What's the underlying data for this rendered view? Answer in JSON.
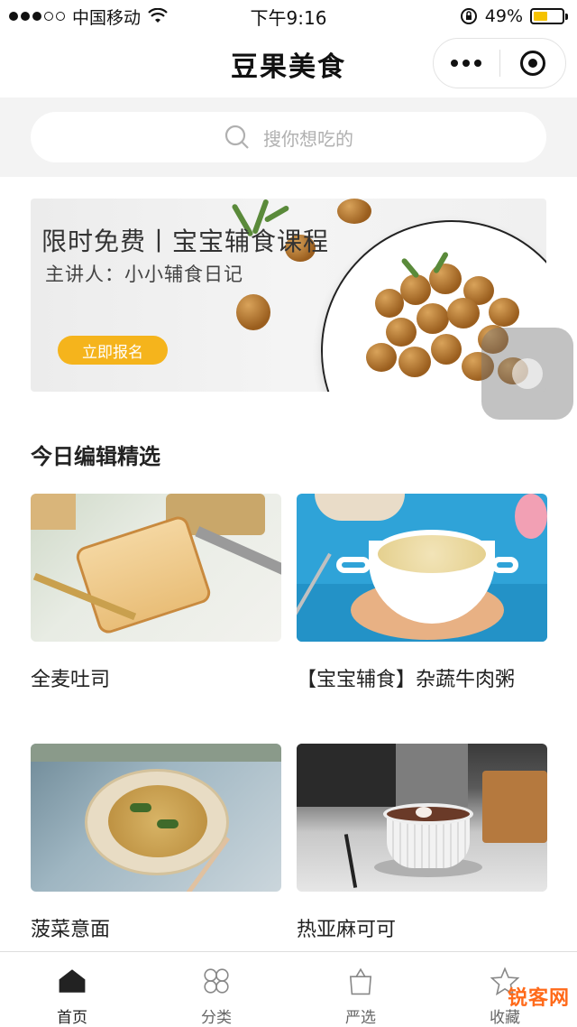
{
  "status_bar": {
    "carrier": "中国移动",
    "time": "下午9:16",
    "battery": "49%",
    "battery_level": 0.49
  },
  "nav": {
    "title": "豆果美食"
  },
  "search": {
    "placeholder": "搜你想吃的"
  },
  "banner": {
    "title": "限时免费丨宝宝辅食课程",
    "subtitle": "主讲人：小小辅食日记",
    "cta": "立即报名"
  },
  "section": {
    "title": "今日编辑精选"
  },
  "cards": [
    {
      "label": "全麦吐司"
    },
    {
      "label": "【宝宝辅食】杂蔬牛肉粥"
    },
    {
      "label": "菠菜意面"
    },
    {
      "label": "热亚麻可可"
    }
  ],
  "tabs": [
    {
      "label": "首页",
      "icon": "home-icon"
    },
    {
      "label": "分类",
      "icon": "category-icon"
    },
    {
      "label": "严选",
      "icon": "bag-icon"
    },
    {
      "label": "收藏",
      "icon": "star-icon"
    }
  ],
  "watermark": {
    "text": "锐客网"
  },
  "colors": {
    "accent": "#f5b41c",
    "battery": "#f5c200"
  }
}
